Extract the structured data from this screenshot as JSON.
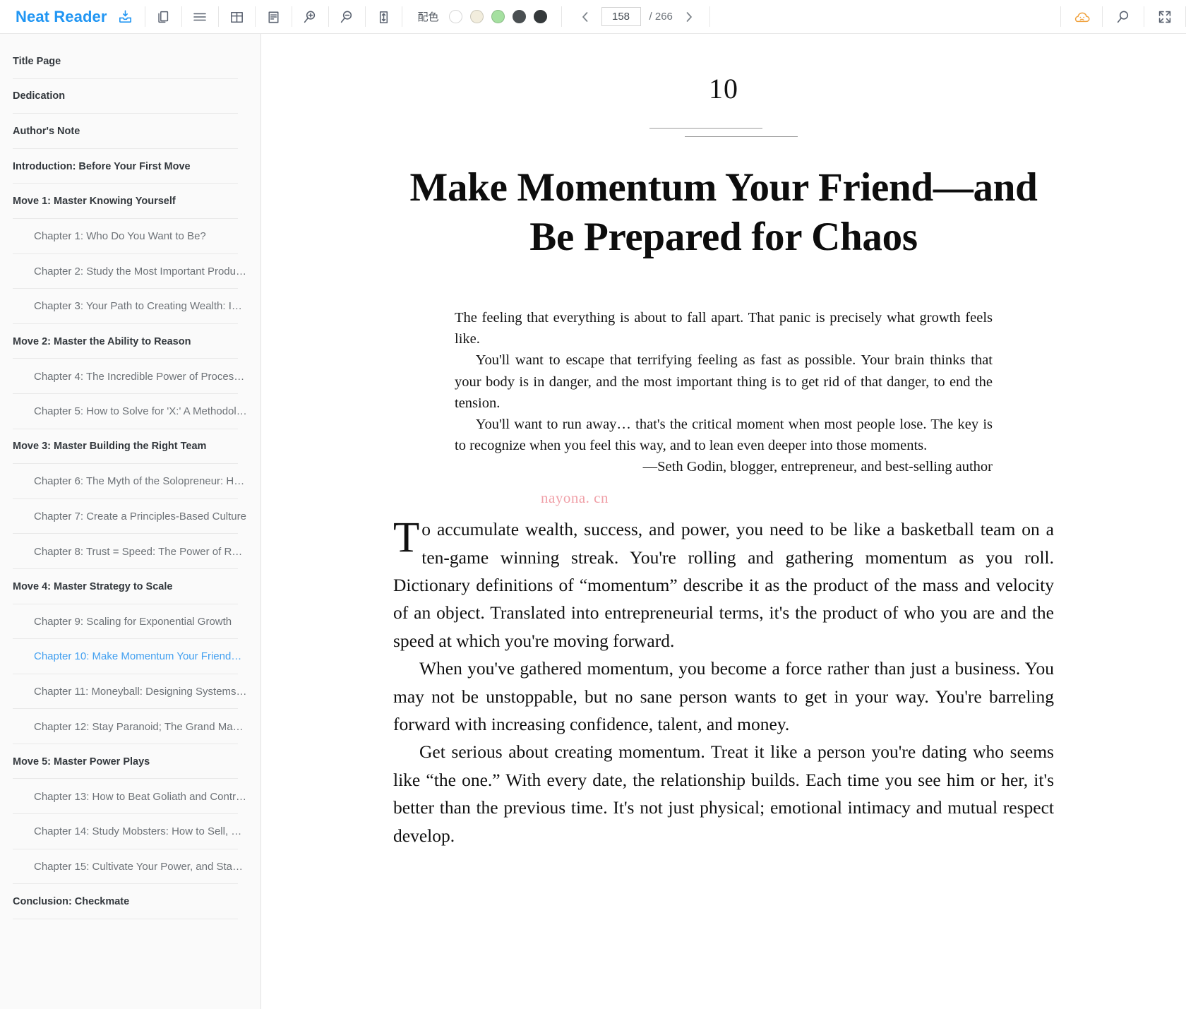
{
  "toolbar": {
    "brand": "Neat Reader",
    "icons": [
      {
        "name": "save-to-library-icon",
        "title": "Save"
      },
      {
        "name": "copy-icon",
        "title": "Copy"
      },
      {
        "name": "menu-lines-icon",
        "title": "Contents"
      },
      {
        "name": "grid-layout-icon",
        "title": "Layout"
      },
      {
        "name": "text-page-icon",
        "title": "Page style"
      },
      {
        "name": "zoom-in-icon",
        "title": "Zoom in"
      },
      {
        "name": "zoom-out-icon",
        "title": "Zoom out"
      },
      {
        "name": "line-height-icon",
        "title": "Line spacing"
      }
    ],
    "theme_label": "配色",
    "theme_swatches": [
      {
        "name": "theme-white",
        "color": "#ffffff"
      },
      {
        "name": "theme-cream",
        "color": "#f2eddd"
      },
      {
        "name": "theme-green",
        "color": "#a5e0a0"
      },
      {
        "name": "theme-dark-gray",
        "color": "#4a4f52"
      },
      {
        "name": "theme-black",
        "color": "#35393b"
      }
    ],
    "pager": {
      "prev_icon": "chevron-left-icon",
      "next_icon": "chevron-right-icon",
      "current_page": "158",
      "total_pages": "/ 266"
    },
    "right_icons": [
      {
        "name": "cloud-sync-icon",
        "title": "Cloud"
      },
      {
        "name": "search-icon",
        "title": "Search"
      },
      {
        "name": "fullscreen-icon",
        "title": "Fullscreen"
      }
    ],
    "accent_color": "#2196f3",
    "cloud_color": "#f0a13c"
  },
  "sidebar": {
    "items": [
      {
        "label": "Title Page",
        "level": 0,
        "active": false
      },
      {
        "label": "Dedication",
        "level": 0,
        "active": false
      },
      {
        "label": "Author's Note",
        "level": 0,
        "active": false
      },
      {
        "label": "Introduction: Before Your First Move",
        "level": 0,
        "active": false
      },
      {
        "label": "Move 1: Master Knowing Yourself",
        "level": 0,
        "active": false
      },
      {
        "label": "Chapter 1: Who Do You Want to Be?",
        "level": 1,
        "active": false
      },
      {
        "label": "Chapter 2: Study the Most Important Produ…",
        "level": 1,
        "active": false
      },
      {
        "label": "Chapter 3: Your Path to Creating Wealth: I…",
        "level": 1,
        "active": false
      },
      {
        "label": "Move 2: Master the Ability to Reason",
        "level": 0,
        "active": false
      },
      {
        "label": "Chapter 4: The Incredible Power of Proces…",
        "level": 1,
        "active": false
      },
      {
        "label": "Chapter 5: How to Solve for 'X:' A Methodol…",
        "level": 1,
        "active": false
      },
      {
        "label": "Move 3: Master Building the Right Team",
        "level": 0,
        "active": false
      },
      {
        "label": "Chapter 6: The Myth of the Solopreneur: H…",
        "level": 1,
        "active": false
      },
      {
        "label": "Chapter 7: Create a Principles-Based Culture",
        "level": 1,
        "active": false
      },
      {
        "label": "Chapter 8: Trust = Speed: The Power of R…",
        "level": 1,
        "active": false
      },
      {
        "label": "Move 4: Master Strategy to Scale",
        "level": 0,
        "active": false
      },
      {
        "label": "Chapter 9: Scaling for Exponential Growth",
        "level": 1,
        "active": false
      },
      {
        "label": "Chapter 10: Make Momentum Your Friend…",
        "level": 1,
        "active": true
      },
      {
        "label": "Chapter 11: Moneyball: Designing Systems…",
        "level": 1,
        "active": false
      },
      {
        "label": "Chapter 12: Stay Paranoid; The Grand Ma…",
        "level": 1,
        "active": false
      },
      {
        "label": "Move 5: Master Power Plays",
        "level": 0,
        "active": false
      },
      {
        "label": "Chapter 13: How to Beat Goliath and Contr…",
        "level": 1,
        "active": false
      },
      {
        "label": "Chapter 14: Study Mobsters: How to Sell, …",
        "level": 1,
        "active": false
      },
      {
        "label": "Chapter 15: Cultivate Your Power, and Sta…",
        "level": 1,
        "active": false
      },
      {
        "label": "Conclusion: Checkmate",
        "level": 0,
        "active": false
      }
    ]
  },
  "reader": {
    "chapter_number": "10",
    "chapter_title": "Make Momentum Your Friend—and Be Prepared for Chaos",
    "epigraph": [
      "The feeling that everything is about to fall apart. That panic is precisely what growth feels like.",
      "You'll want to escape that terrifying feeling as fast as possible. Your brain thinks that your body is in danger, and the most important thing is to get rid of that danger, to end the tension.",
      "You'll want to run away… that's the critical moment when most people lose. The key is to recognize when you feel this way, and to lean even deeper into those moments."
    ],
    "epigraph_attribution": "—Seth Godin, blogger, entrepreneur, and best-selling author",
    "watermark": "nayona. cn",
    "watermark_color": "#f0a0a8",
    "dropcap": "T",
    "paragraphs": [
      "o accumulate wealth, success, and power, you need to be like a basketball team on a ten-game winning streak. You're rolling and gathering momentum as you roll. Dictionary definitions of “momentum” describe it as the product of the mass and velocity of an object. Translated into entrepreneurial terms, it's the product of who you are and the speed at which you're moving forward.",
      "When you've gathered momentum, you become a force rather than just a business. You may not be unstoppable, but no sane person wants to get in your way. You're barreling forward with increasing confidence, talent, and money.",
      "Get serious about creating momentum. Treat it like a person you're dating who seems like “the one.” With every date, the relationship builds. Each time you see him or her, it's better than the previous time. It's not just physical; emotional intimacy and mutual respect develop."
    ]
  }
}
